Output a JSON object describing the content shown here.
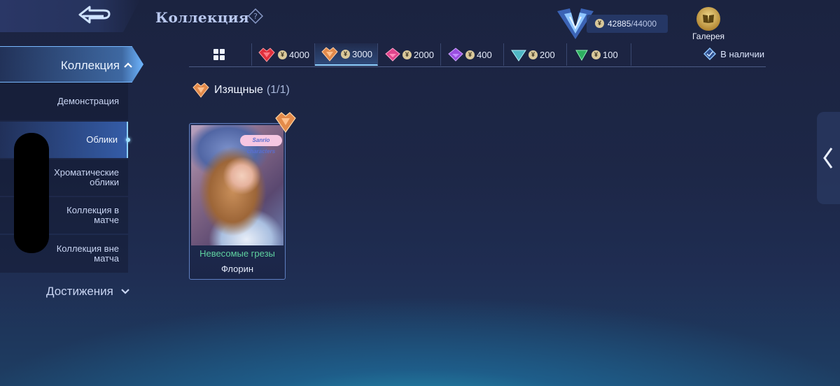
{
  "header": {
    "title": "Коллекция",
    "points_current": "42885",
    "points_max": "/44000",
    "gallery_label": "Галерея"
  },
  "sidebar": {
    "header_label": "Коллекция",
    "items": [
      {
        "label": "Демонстрация"
      },
      {
        "label": "Облики"
      },
      {
        "label": "Хроматические облики"
      },
      {
        "label": "Коллекция в матче"
      },
      {
        "label": "Коллекция вне матча"
      }
    ],
    "achievements_label": "Достижения"
  },
  "tabs": [
    {
      "value": "4000",
      "color": "#e0303c"
    },
    {
      "value": "3000",
      "color": "#e38a4a"
    },
    {
      "value": "2000",
      "color": "#e0458c"
    },
    {
      "value": "400",
      "color": "#9a4ee0"
    },
    {
      "value": "200",
      "color": "#4fb7c4"
    },
    {
      "value": "100",
      "color": "#2db060"
    }
  ],
  "in_stock_label": "В наличии",
  "category": {
    "name": "Изящные",
    "count": "(1/1)"
  },
  "cards": [
    {
      "skin_name": "Невесомые грезы",
      "hero_name": "Флорин",
      "logo": "Sanrio characters"
    }
  ],
  "colors": {
    "accent": "#8fd1ff",
    "skin_name": "#5fd2a0",
    "notification": "#ff8a3a"
  }
}
